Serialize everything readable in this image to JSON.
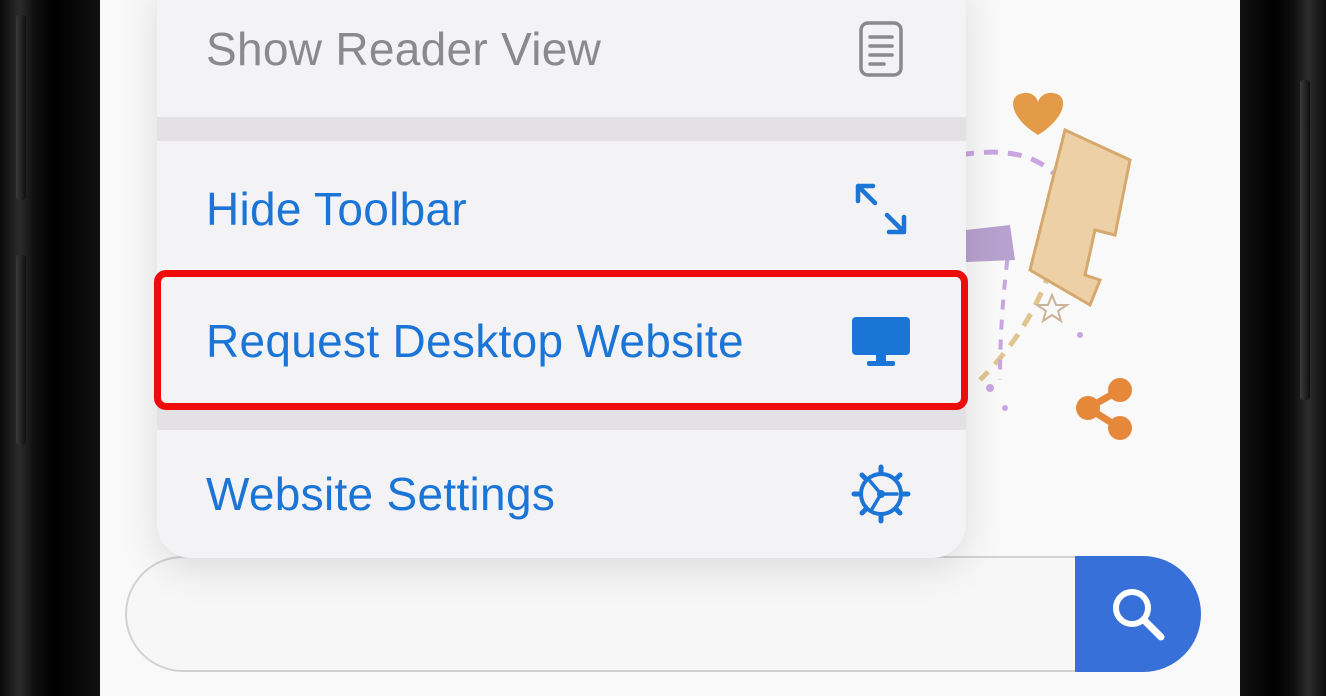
{
  "colors": {
    "accent": "#1b75d6",
    "disabled_text": "#8a8a8e",
    "search_button": "#3670d8",
    "highlight": "#ee0b0b",
    "menu_background": "#f3f2f4"
  },
  "menu": {
    "items": [
      {
        "label": "Show Reader View",
        "icon": "reader-view-icon",
        "enabled": false
      },
      {
        "label": "Hide Toolbar",
        "icon": "expand-arrows-icon",
        "enabled": true
      },
      {
        "label": "Request Desktop Website",
        "icon": "desktop-monitor-icon",
        "enabled": true,
        "highlighted": true
      },
      {
        "label": "Website Settings",
        "icon": "gear-icon",
        "enabled": true
      }
    ]
  },
  "search": {
    "value": "",
    "button_icon": "magnifier-icon"
  },
  "illustration": {
    "icons": [
      "heart-icon",
      "share-icon"
    ]
  }
}
